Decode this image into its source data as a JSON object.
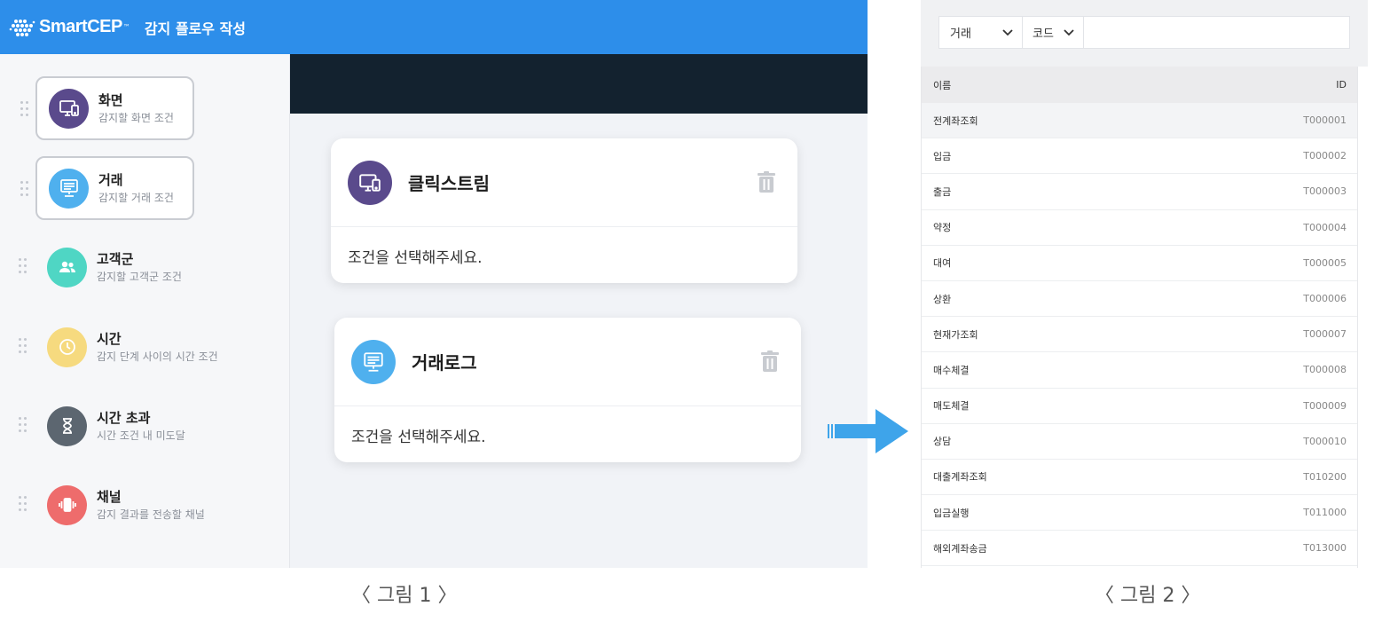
{
  "app": {
    "brand": "SmartCEP",
    "brand_tm": "™",
    "page_title": "감지 플로우 작성"
  },
  "sidebar": {
    "items": [
      {
        "title": "화면",
        "subtitle": "감지할 화면 조건",
        "icon": "monitor-icon",
        "color": "#5a4a8c",
        "selected": true
      },
      {
        "title": "거래",
        "subtitle": "감지할 거래 조건",
        "icon": "transaction-terminal-icon",
        "color": "#4fb0ee",
        "selected": true
      },
      {
        "title": "고객군",
        "subtitle": "감지할 고객군 조건",
        "icon": "users-icon",
        "color": "#4fd6c4",
        "selected": false
      },
      {
        "title": "시간",
        "subtitle": "감지 단계 사이의 시간 조건",
        "icon": "clock-icon",
        "color": "#f6da7f",
        "selected": false
      },
      {
        "title": "시간 초과",
        "subtitle": "시간 조건 내 미도달",
        "icon": "hourglass-icon",
        "color": "#5c6670",
        "selected": false
      },
      {
        "title": "채널",
        "subtitle": "감지 결과를 전송할 채널",
        "icon": "phone-vibrate-icon",
        "color": "#ee6c6c",
        "selected": false
      }
    ]
  },
  "flow_cards": [
    {
      "title": "클릭스트림",
      "body": "조건을 선택해주세요.",
      "icon": "monitor-icon",
      "color": "#5a4a8c"
    },
    {
      "title": "거래로그",
      "body": "조건을 선택해주세요.",
      "icon": "transaction-terminal-icon",
      "color": "#4fb0ee"
    }
  ],
  "captions": {
    "fig1": "〈 그림 1 〉",
    "fig2": "〈 그림 2 〉"
  },
  "filter": {
    "type_select": "거래",
    "field_select": "코드",
    "input_value": ""
  },
  "table": {
    "columns": [
      "이름",
      "ID"
    ],
    "rows": [
      [
        "전계좌조회",
        "T000001"
      ],
      [
        "입금",
        "T000002"
      ],
      [
        "출금",
        "T000003"
      ],
      [
        "약정",
        "T000004"
      ],
      [
        "대여",
        "T000005"
      ],
      [
        "상환",
        "T000006"
      ],
      [
        "현재가조회",
        "T000007"
      ],
      [
        "매수체결",
        "T000008"
      ],
      [
        "매도체결",
        "T000009"
      ],
      [
        "상담",
        "T000010"
      ],
      [
        "대출계좌조회",
        "T010200"
      ],
      [
        "입금실행",
        "T011000"
      ],
      [
        "해외계좌송금",
        "T013000"
      ]
    ]
  },
  "colors": {
    "topbar": "#2d8eea",
    "darkband": "#13222f",
    "arrow": "#3ea4ea"
  }
}
